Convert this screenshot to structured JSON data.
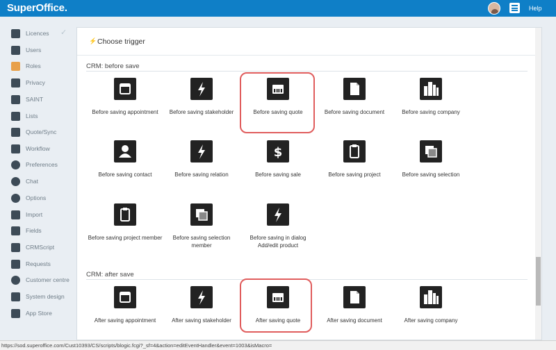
{
  "app": {
    "logo": "SuperOffice.",
    "help_label": "Help"
  },
  "sidebar": {
    "items": [
      {
        "label": "Licences",
        "icon": "lock-icon"
      },
      {
        "label": "Users",
        "icon": "user-icon"
      },
      {
        "label": "Roles",
        "icon": "roles-icon"
      },
      {
        "label": "Privacy",
        "icon": "shield-icon"
      },
      {
        "label": "SAINT",
        "icon": "bar-chart-icon"
      },
      {
        "label": "Lists",
        "icon": "list-icon"
      },
      {
        "label": "Quote/Sync",
        "icon": "barcode-icon"
      },
      {
        "label": "Workflow",
        "icon": "signpost-icon"
      },
      {
        "label": "Preferences",
        "icon": "gear-icon"
      },
      {
        "label": "Chat",
        "icon": "chat-icon"
      },
      {
        "label": "Options",
        "icon": "cog-icon"
      },
      {
        "label": "Import",
        "icon": "import-icon"
      },
      {
        "label": "Fields",
        "icon": "fields-icon"
      },
      {
        "label": "CRMScript",
        "icon": "script-icon"
      },
      {
        "label": "Requests",
        "icon": "ticket-icon"
      },
      {
        "label": "Customer centre",
        "icon": "help-icon"
      },
      {
        "label": "System design",
        "icon": "design-icon"
      },
      {
        "label": "App Store",
        "icon": "store-icon"
      }
    ]
  },
  "panel": {
    "title": "Choose trigger"
  },
  "sections": {
    "before_title": "CRM: before save",
    "after_title": "CRM: after save"
  },
  "before_tiles": [
    {
      "label": "Before saving appointment",
      "icon": "calendar-icon"
    },
    {
      "label": "Before saving stakeholder",
      "icon": "bolt-icon"
    },
    {
      "label": "Before saving quote",
      "icon": "quote-icon"
    },
    {
      "label": "Before saving document",
      "icon": "document-icon"
    },
    {
      "label": "Before saving company",
      "icon": "company-icon"
    },
    {
      "label": "Before saving contact",
      "icon": "contact-icon"
    },
    {
      "label": "Before saving relation",
      "icon": "bolt-icon"
    },
    {
      "label": "Before saving sale",
      "icon": "dollar-icon"
    },
    {
      "label": "Before saving project",
      "icon": "clipboard-icon"
    },
    {
      "label": "Before saving selection",
      "icon": "selection-icon"
    },
    {
      "label": "Before saving project member",
      "icon": "clipboard-icon"
    },
    {
      "label": "Before saving selection member",
      "icon": "selection-icon"
    },
    {
      "label": "Before saving in dialog Add/edit product",
      "icon": "bolt-icon"
    }
  ],
  "after_tiles": [
    {
      "label": "After saving appointment",
      "icon": "calendar-icon"
    },
    {
      "label": "After saving stakeholder",
      "icon": "bolt-icon"
    },
    {
      "label": "After saving quote",
      "icon": "quote-icon"
    },
    {
      "label": "After saving document",
      "icon": "document-icon"
    },
    {
      "label": "After saving company",
      "icon": "company-icon"
    }
  ],
  "status_bar": {
    "url": "https://sod.superoffice.com/Cust10393/CS/scripts/blogic.fcgi?_sf=4&action=editEventHandler&event=1003&isMacro="
  },
  "colors": {
    "topbar": "#0f7fc7",
    "highlight": "#e05c5c",
    "tile_icon": "#222222"
  }
}
